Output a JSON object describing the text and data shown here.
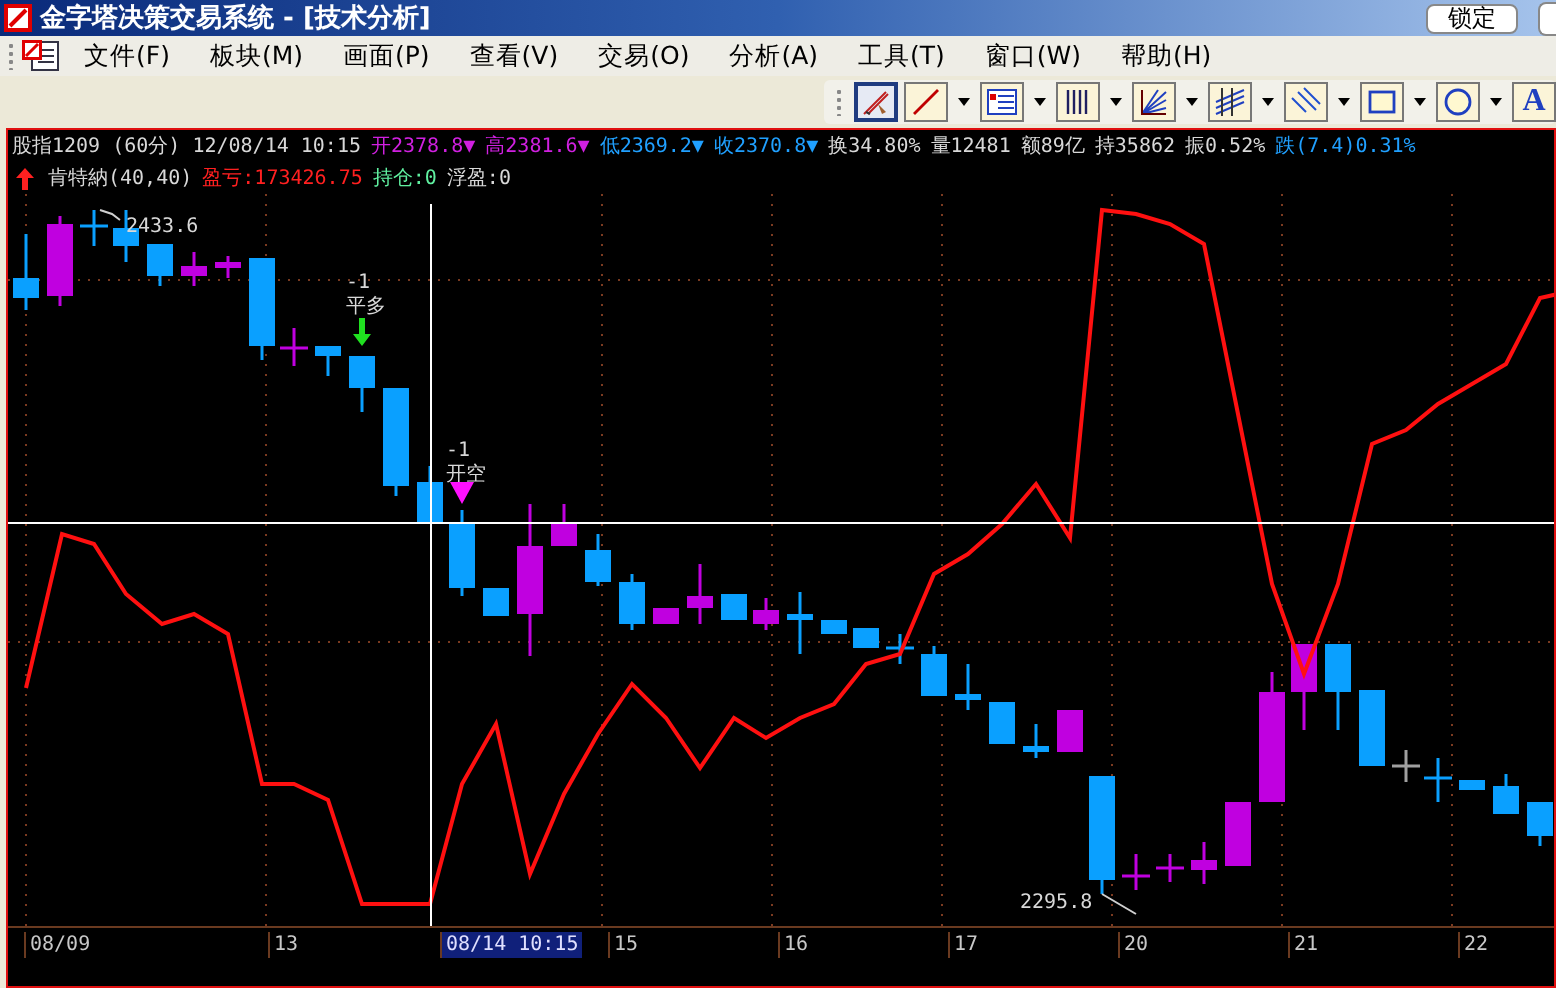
{
  "window": {
    "title": "金字塔决策交易系统 - [技术分析]",
    "buttons": [
      "锁定"
    ]
  },
  "menu": [
    "文件(F)",
    "板块(M)",
    "画面(P)",
    "查看(V)",
    "交易(O)",
    "分析(A)",
    "工具(T)",
    "窗口(W)",
    "帮助(H)"
  ],
  "toolbar": {
    "tools": [
      {
        "kind": "pencil",
        "selected": true,
        "dropdown": false
      },
      {
        "kind": "line",
        "selected": false,
        "dropdown": true
      },
      {
        "kind": "list",
        "selected": false,
        "dropdown": true
      },
      {
        "kind": "bars",
        "selected": false,
        "dropdown": true
      },
      {
        "kind": "fan",
        "selected": false,
        "dropdown": true
      },
      {
        "kind": "channel",
        "selected": false,
        "dropdown": true
      },
      {
        "kind": "diagonal",
        "selected": false,
        "dropdown": true
      },
      {
        "kind": "rectangle",
        "selected": false,
        "dropdown": true
      },
      {
        "kind": "circle",
        "selected": false,
        "dropdown": true
      },
      {
        "kind": "text",
        "label": "A",
        "selected": false,
        "dropdown": false
      }
    ]
  },
  "quote": {
    "items": [
      {
        "text": "股指1209 (60分) 12/08/14 10:15",
        "color": "#d8d8d8"
      },
      {
        "text": "开2378.8▼",
        "color": "#d020e0"
      },
      {
        "text": "高2381.6▼",
        "color": "#d020e0"
      },
      {
        "text": "低2369.2▼",
        "color": "#20a0ff"
      },
      {
        "text": "收2370.8▼",
        "color": "#20a0ff"
      },
      {
        "text": "换34.80%",
        "color": "#d8d8d8"
      },
      {
        "text": "量12481",
        "color": "#d8d8d8"
      },
      {
        "text": "额89亿",
        "color": "#d8d8d8"
      },
      {
        "text": "持35862",
        "color": "#d8d8d8"
      },
      {
        "text": "振0.52%",
        "color": "#d8d8d8"
      },
      {
        "text": "跌(7.4)0.31%",
        "color": "#20a0ff"
      }
    ]
  },
  "indicator": {
    "items": [
      {
        "text": "肯特納(40,40)",
        "color": "#d8d8d8"
      },
      {
        "text": "盈亏:173426.75",
        "color": "#ff2020"
      },
      {
        "text": "持仓:0",
        "color": "#60f0a0"
      },
      {
        "text": "浮盈:0",
        "color": "#d8d8d8"
      }
    ]
  },
  "chart": {
    "high_label": "2433.6",
    "low_label": "2295.8",
    "signals": [
      {
        "kind": "close_long",
        "count": "-1",
        "label": "平多"
      },
      {
        "kind": "open_short",
        "count": "-1",
        "label": "开空"
      }
    ]
  },
  "x_axis": {
    "labels": [
      {
        "text": "08/09",
        "selected": false
      },
      {
        "text": "13",
        "selected": false
      },
      {
        "text": "08/14 10:15",
        "selected": true
      },
      {
        "text": "15",
        "selected": false
      },
      {
        "text": "16",
        "selected": false
      },
      {
        "text": "17",
        "selected": false
      },
      {
        "text": "20",
        "selected": false
      },
      {
        "text": "21",
        "selected": false
      },
      {
        "text": "22",
        "selected": false
      }
    ]
  }
}
